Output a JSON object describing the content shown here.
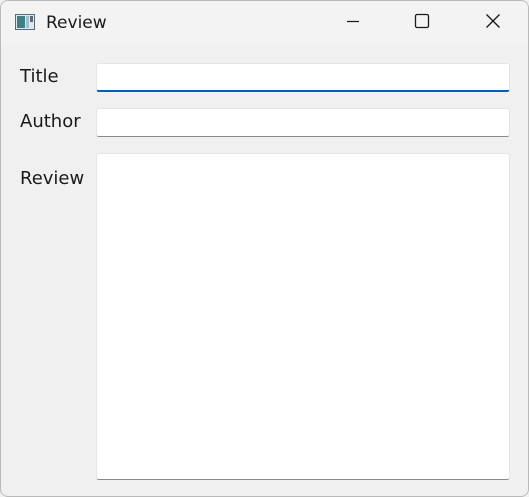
{
  "window": {
    "title": "Review",
    "icon": "app-window-icon",
    "controls": {
      "minimize_icon": "minimize-icon",
      "maximize_icon": "maximize-icon",
      "close_icon": "close-icon"
    }
  },
  "form": {
    "title_label": "Title",
    "title_value": "",
    "author_label": "Author",
    "author_value": "",
    "review_label": "Review",
    "review_value": ""
  },
  "colors": {
    "focus_accent": "#005fb8",
    "window_bg": "#f0f0f0",
    "field_bg": "#ffffff"
  }
}
